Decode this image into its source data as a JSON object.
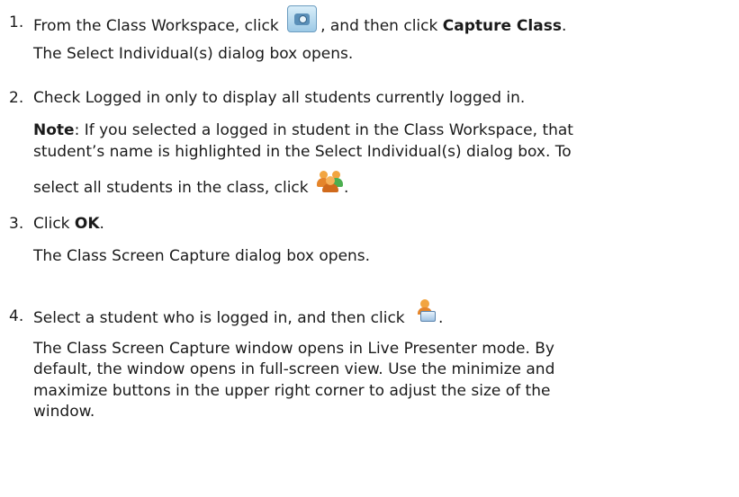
{
  "steps": [
    {
      "number": "1.",
      "text_before": "From the Class Workspace, click",
      "icon": "camera-icon",
      "text_after": ", and then click",
      "bold": "Capture Class",
      "end": ".",
      "result": "The Select Individual(s) dialog box opens."
    },
    {
      "number": "2.",
      "text": "Check Logged in only to display all students currently logged in.",
      "note_label": "Note",
      "note_line1": ": If you selected a logged in student in the Class Workspace, that",
      "note_line2": "student’s name is highlighted in the Select Individual(s) dialog box. To",
      "note_line3": "select all students in the class, click",
      "note_icon": "group-users-icon",
      "note_end": "."
    },
    {
      "number": "3.",
      "text_before": "Click",
      "bold": "OK",
      "end": ".",
      "result": "The Class Screen Capture dialog box opens."
    },
    {
      "number": "4.",
      "text_before": "Select a student who is logged in, and then click",
      "icon": "live-presenter-icon",
      "end": ".",
      "result_lines": [
        "The Class Screen Capture window opens in Live Presenter mode. By",
        "default, the window opens in full-screen view. Use the minimize and",
        "maximize buttons in the upper right corner to adjust the size of the",
        "window."
      ]
    }
  ]
}
